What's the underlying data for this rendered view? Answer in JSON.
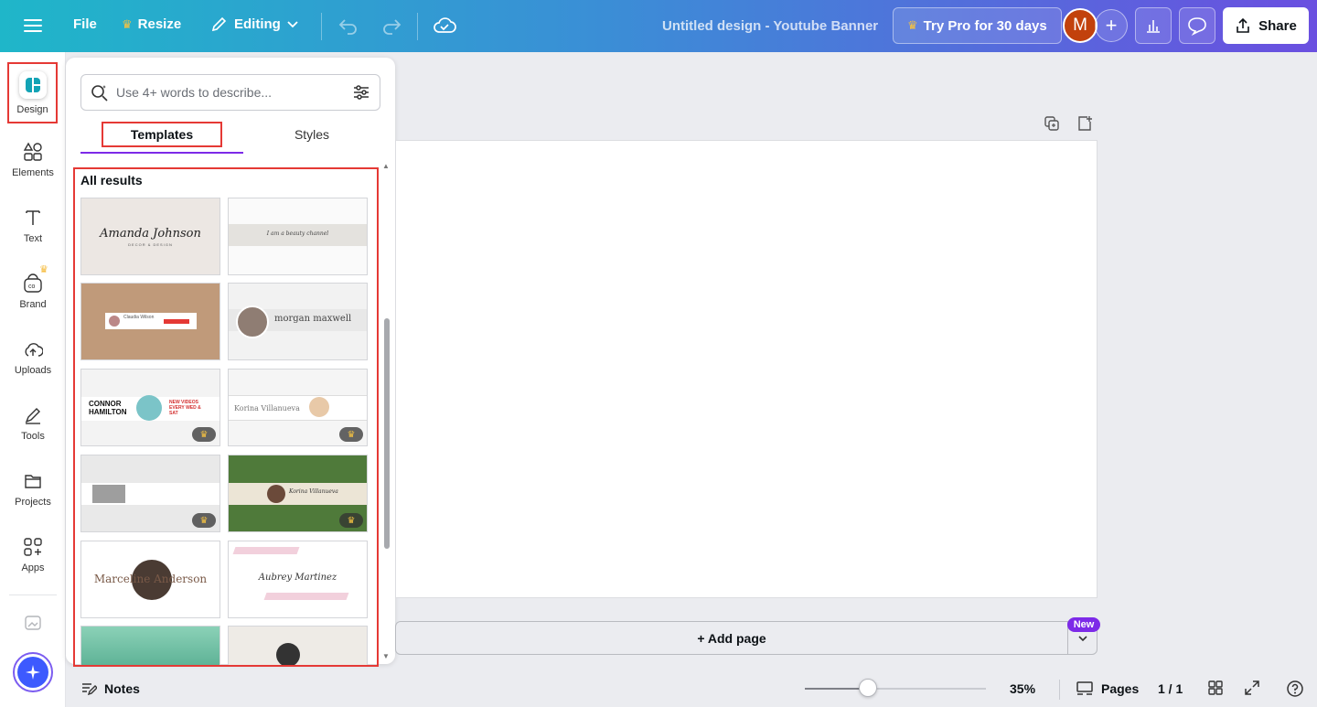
{
  "topbar": {
    "file_label": "File",
    "resize_label": "Resize",
    "editing_label": "Editing",
    "doc_title": "Untitled design - Youtube Banner",
    "try_pro_label": "Try Pro for 30 days",
    "avatar_initial": "M",
    "share_label": "Share"
  },
  "rail": {
    "items": [
      {
        "label": "Design",
        "icon": "design-icon"
      },
      {
        "label": "Elements",
        "icon": "elements-icon"
      },
      {
        "label": "Text",
        "icon": "text-icon"
      },
      {
        "label": "Brand",
        "icon": "brand-icon"
      },
      {
        "label": "Uploads",
        "icon": "uploads-icon"
      },
      {
        "label": "Tools",
        "icon": "tools-icon"
      },
      {
        "label": "Projects",
        "icon": "projects-icon"
      },
      {
        "label": "Apps",
        "icon": "apps-icon"
      }
    ]
  },
  "panel": {
    "search_placeholder": "Use 4+ words to describe...",
    "tabs": [
      "Templates",
      "Styles"
    ],
    "results_heading": "All results",
    "templates": [
      {
        "name": "Amanda Johnson",
        "subtitle": "DECOR & DESIGN",
        "pro": false
      },
      {
        "name": "I am a beauty channel",
        "pro": false
      },
      {
        "name": "Claudia Wilson",
        "pro": false
      },
      {
        "name": "morgan maxwell",
        "pro": false
      },
      {
        "name": "CONNOR HAMILTON",
        "extra": "NEW VIDEOS EVERY WED & SAT",
        "pro": true
      },
      {
        "name": "Korina Villanueva",
        "pro": true
      },
      {
        "name": "",
        "pro": true
      },
      {
        "name": "Korina Villanueva",
        "pro": true
      },
      {
        "name": "Marceline Anderson",
        "pro": false
      },
      {
        "name": "Aubrey Martinez",
        "pro": false
      },
      {
        "name": "",
        "pro": false
      },
      {
        "name": "",
        "pro": false
      }
    ]
  },
  "canvas": {
    "add_page_label": "+ Add page",
    "new_badge": "New"
  },
  "bottombar": {
    "notes_label": "Notes",
    "zoom": "35%",
    "zoom_fraction": 0.35,
    "pages_label": "Pages",
    "page_count": "1 / 1"
  },
  "colors": {
    "accent": "#7d2ae8",
    "highlight_border": "#e53935",
    "gradient_start": "#1fb6c9",
    "gradient_end": "#6a4fe0"
  }
}
